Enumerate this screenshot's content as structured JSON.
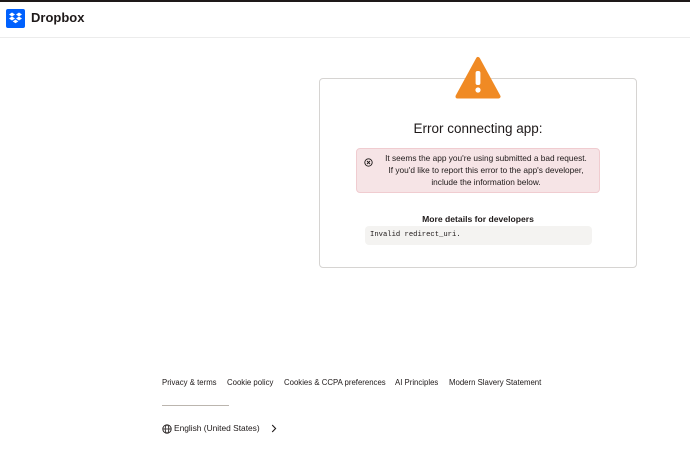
{
  "header": {
    "brand": "Dropbox",
    "logo_icon": "dropbox-logo-icon",
    "brand_color": "#0061fe"
  },
  "error_card": {
    "warning_icon": "warning-triangle-icon",
    "warning_color": "#f08a24",
    "title": "Error connecting app:",
    "message_icon": "circle-x-icon",
    "message_line1": "It seems the app you're using submitted a bad request.",
    "message_line2": "If you'd like to report this error to the app's developer,",
    "message_line3": "include the information below.",
    "details_title": "More details for developers",
    "details_code": "Invalid redirect_uri."
  },
  "footer": {
    "links": [
      "Privacy & terms",
      "Cookie policy",
      "Cookies & CCPA preferences",
      "AI Principles",
      "Modern Slavery Statement"
    ],
    "language_icon": "globe-icon",
    "language": "English (United States)",
    "language_chevron": "chevron-right-icon"
  }
}
